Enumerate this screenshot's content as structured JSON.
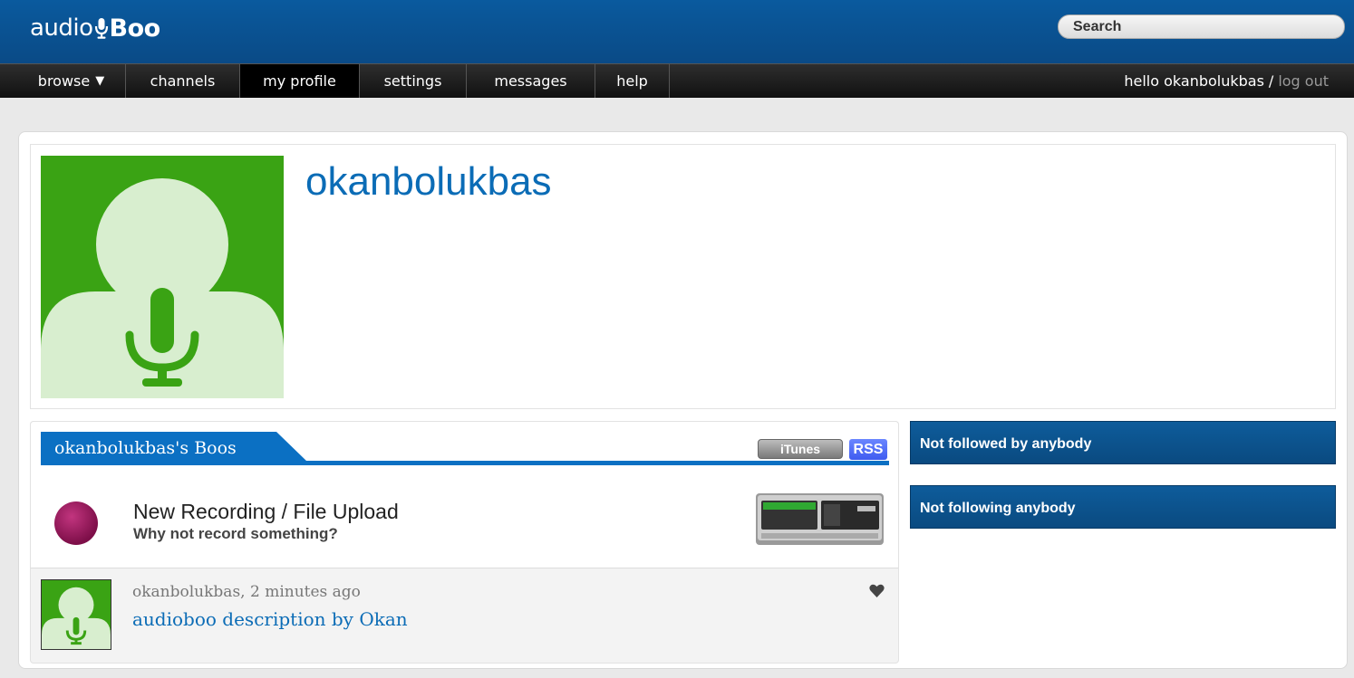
{
  "header": {
    "logo_audio": "audio",
    "logo_boo": "Boo",
    "search_placeholder": "Search"
  },
  "nav": {
    "items": [
      {
        "label": "browse",
        "has_caret": true
      },
      {
        "label": "channels"
      },
      {
        "label": "my profile",
        "active": true
      },
      {
        "label": "settings"
      },
      {
        "label": "messages"
      },
      {
        "label": "help"
      }
    ],
    "greeting": "hello okanbolukbas",
    "separator": "/",
    "logout": "log out"
  },
  "profile": {
    "username": "okanbolukbas"
  },
  "boos": {
    "tab_label": "okanbolukbas's Boos",
    "itunes_label": "iTunes",
    "rss_label": "RSS",
    "new_recording_title": "New Recording / File Upload",
    "new_recording_subtitle": "Why not record something?",
    "items": [
      {
        "meta": "okanbolukbas, 2 minutes ago",
        "description": "audioboo description by Okan"
      }
    ]
  },
  "sidebar": {
    "followers": "Not followed by anybody",
    "following": "Not following anybody"
  },
  "colors": {
    "header_blue": "#0a5a9e",
    "link_blue": "#0b6cb6",
    "avatar_green": "#3aa314",
    "avatar_light": "#d8eecf",
    "record_magenta": "#9c1b60"
  }
}
